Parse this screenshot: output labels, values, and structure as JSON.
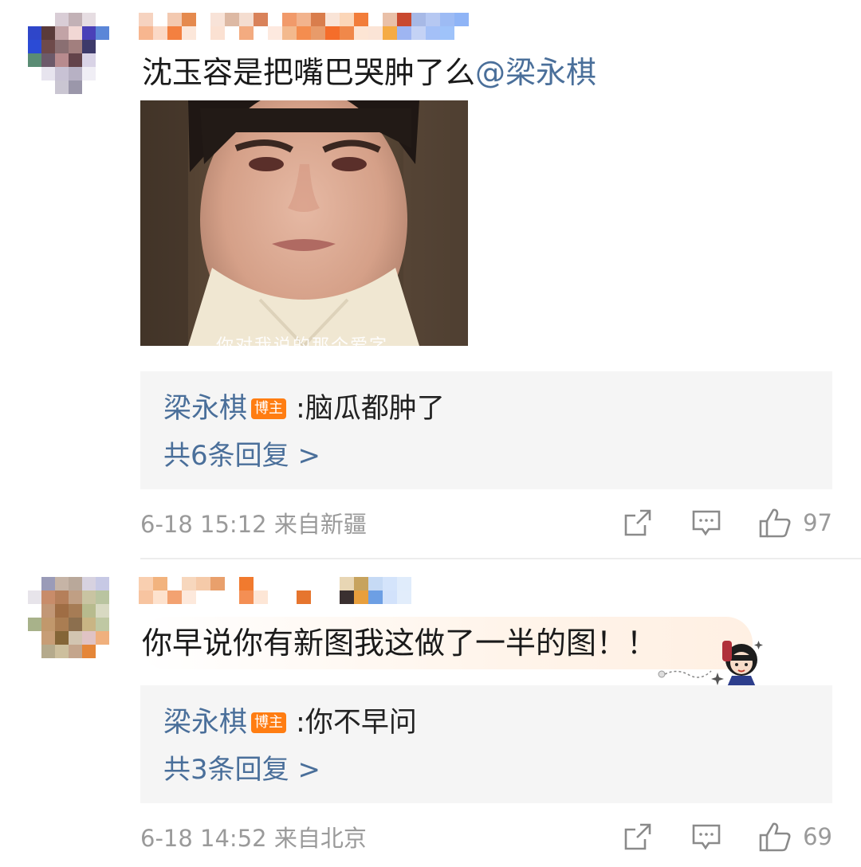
{
  "comments": [
    {
      "text": "沈玉容是把嘴巴哭肿了么",
      "mention": "@梁永棋",
      "image_subtitle": "你对我说的那个爱字",
      "reply": {
        "author": "梁永棋",
        "badge": "博主",
        "colon": ":",
        "text": "脑瓜都肿了",
        "count_label": "共6条回复 >"
      },
      "meta": "6-18 15:12  来自新疆",
      "likes": "97"
    },
    {
      "text": "你早说你有新图我这做了一半的图！！",
      "reply": {
        "author": "梁永棋",
        "badge": "博主",
        "colon": ":",
        "text": "你不早问",
        "count_label": "共3条回复 >"
      },
      "meta": "6-18 14:52  来自北京",
      "likes": "69"
    }
  ],
  "icons": {
    "share": "share-icon",
    "comment": "comment-icon",
    "like": "thumbs-up-icon"
  },
  "colors": {
    "link_blue": "#4a6f9a",
    "badge_orange": "#ff7d12",
    "meta_gray": "#9a9a9a",
    "reply_bg": "#f5f5f5"
  }
}
